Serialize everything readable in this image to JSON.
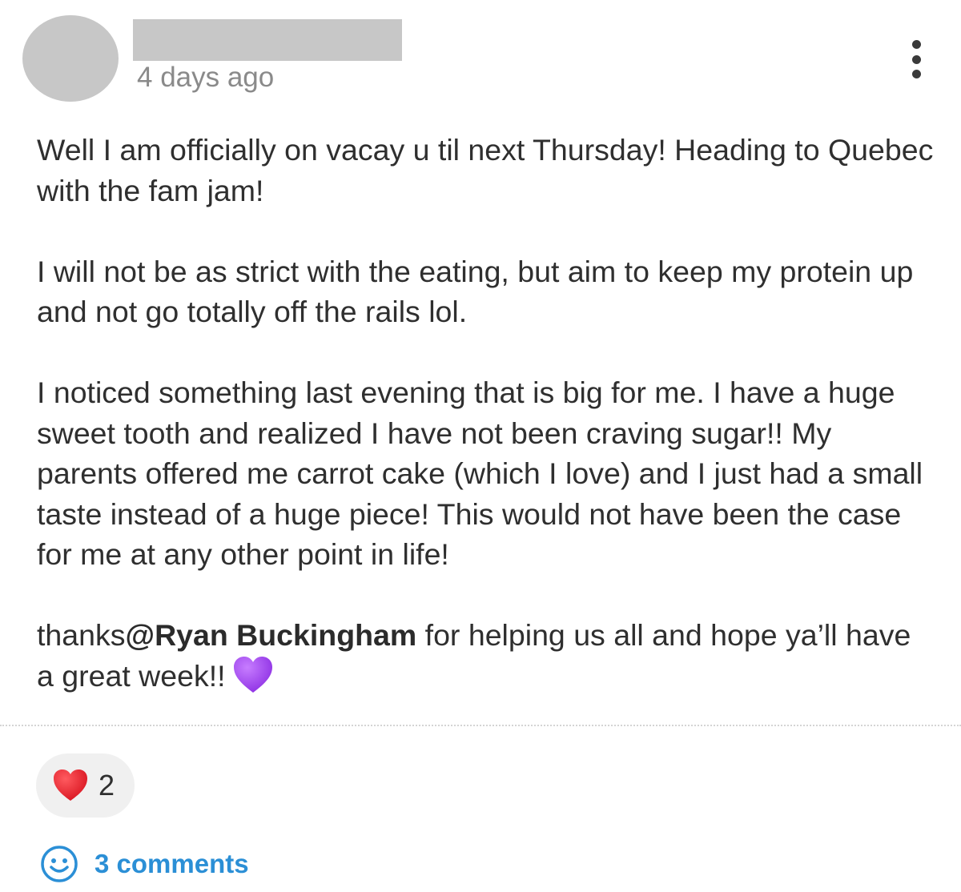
{
  "post": {
    "timestamp": "4 days ago",
    "paragraphs": {
      "p1": "Well I am officially on vacay u til next Thursday! Heading to Quebec with the fam jam!",
      "p2": "I will not be as strict with the eating, but aim to keep my protein up and not go totally off the rails lol.",
      "p3": "I noticed something last evening that is big for me. I have a huge sweet tooth and realized I have not been craving sugar!! My parents offered me carrot cake (which I love) and I just had a small taste instead of a huge piece! This would not have been the case for me at any other point in life!",
      "p4_prefix": "thanks",
      "p4_mention": "@Ryan Buckingham",
      "p4_suffix": " for helping us all and hope ya’ll have a great week!!"
    },
    "inline_emoji": "purple-heart-icon"
  },
  "reactions": {
    "icon": "red-heart-icon",
    "count": "2"
  },
  "comments": {
    "icon": "smiley-icon",
    "label": "3 comments"
  },
  "colors": {
    "placeholder_gray": "#c7c7c7",
    "timestamp_gray": "#8a8a8a",
    "text": "#2f2f2f",
    "link_blue": "#2b8fd6",
    "pill_bg": "#f0f0f0",
    "heart_red": "#e0202a",
    "heart_purple": "#9b3fe0"
  }
}
